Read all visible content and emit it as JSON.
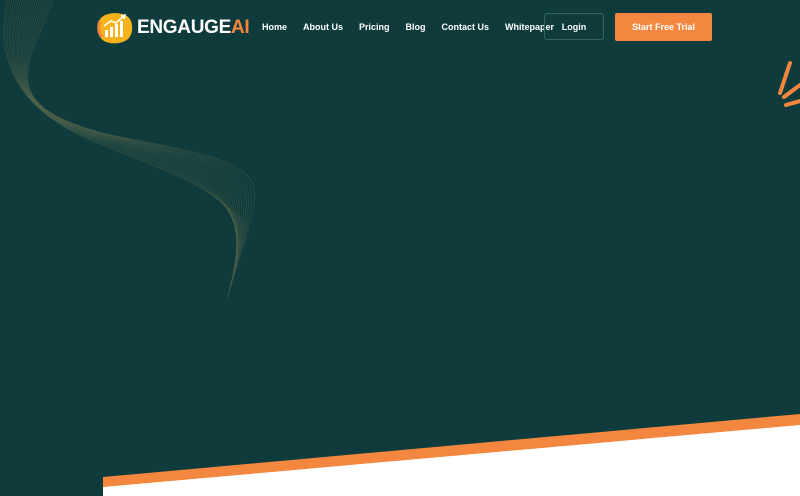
{
  "brand": {
    "name_main": "ENGAUGE",
    "name_accent": "AI"
  },
  "nav": {
    "links": [
      "Home",
      "About Us",
      "Pricing",
      "Blog",
      "Contact Us",
      "Whitepaper"
    ]
  },
  "actions": {
    "login_label": "Login",
    "trial_label": "Start Free Trial"
  },
  "colors": {
    "background": "#0f3b3c",
    "accent": "#f4873f",
    "white": "#ffffff"
  },
  "icons": {
    "logo": "bar-chart-growth-icon",
    "decoration": "rays-icon"
  }
}
